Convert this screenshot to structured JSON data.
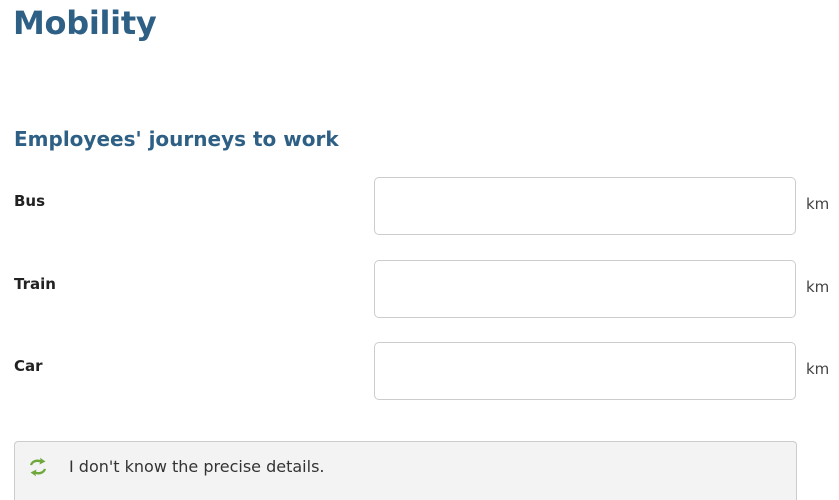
{
  "page": {
    "title": "Mobility"
  },
  "section": {
    "title": "Employees' journeys to work"
  },
  "rows": [
    {
      "label": "Bus",
      "value": "",
      "unit": "km"
    },
    {
      "label": "Train",
      "value": "",
      "unit": "km"
    },
    {
      "label": "Car",
      "value": "",
      "unit": "km"
    }
  ],
  "unknown_option": {
    "label": "I don't know the precise details.",
    "icon": "refresh-arrows-icon"
  },
  "colors": {
    "heading": "#2e5f85",
    "icon": "#6fa83a"
  }
}
